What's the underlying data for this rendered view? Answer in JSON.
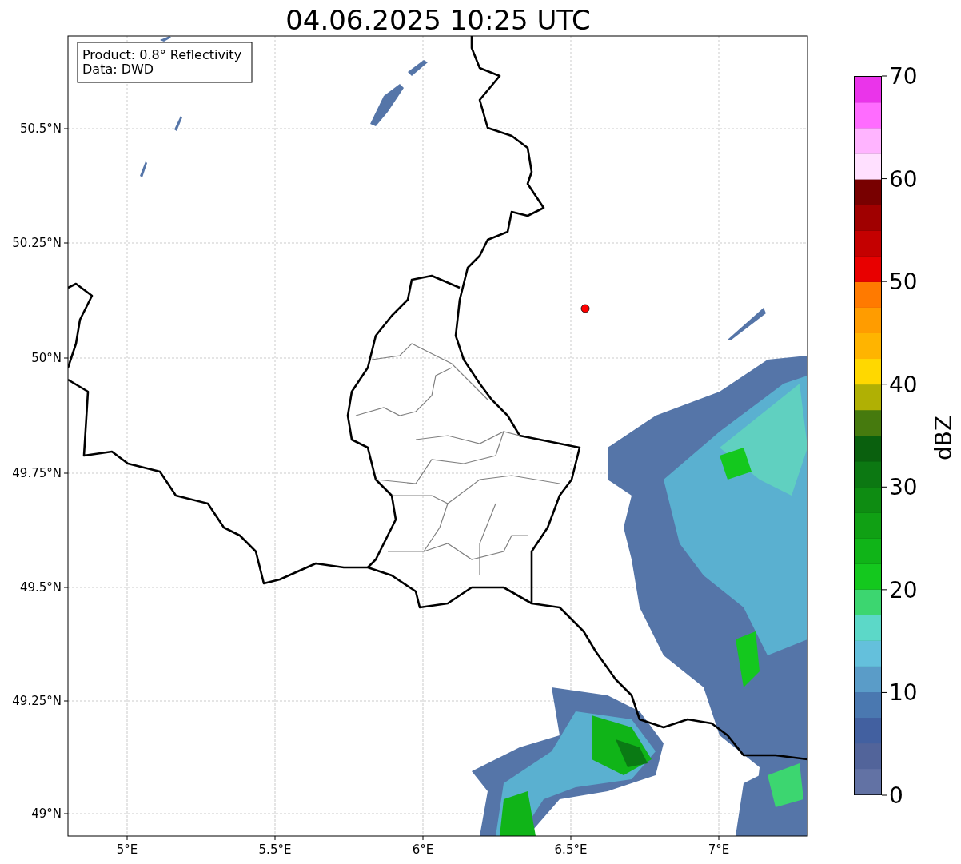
{
  "title": "04.06.2025 10:25 UTC",
  "annotation": [
    "Product: 0.8° Reflectivity",
    "Data: DWD"
  ],
  "map": {
    "x_ticks": [
      "5°E",
      "5.5°E",
      "6°E",
      "6.5°E",
      "7°E"
    ],
    "y_ticks": [
      "50.5°N",
      "50.25°N",
      "50°N",
      "49.75°N",
      "49.5°N",
      "49.25°N",
      "49°N"
    ]
  },
  "colorbar": {
    "label": "dBZ",
    "ticks": [
      "70",
      "60",
      "50",
      "40",
      "30",
      "20",
      "10",
      "0"
    ]
  }
}
